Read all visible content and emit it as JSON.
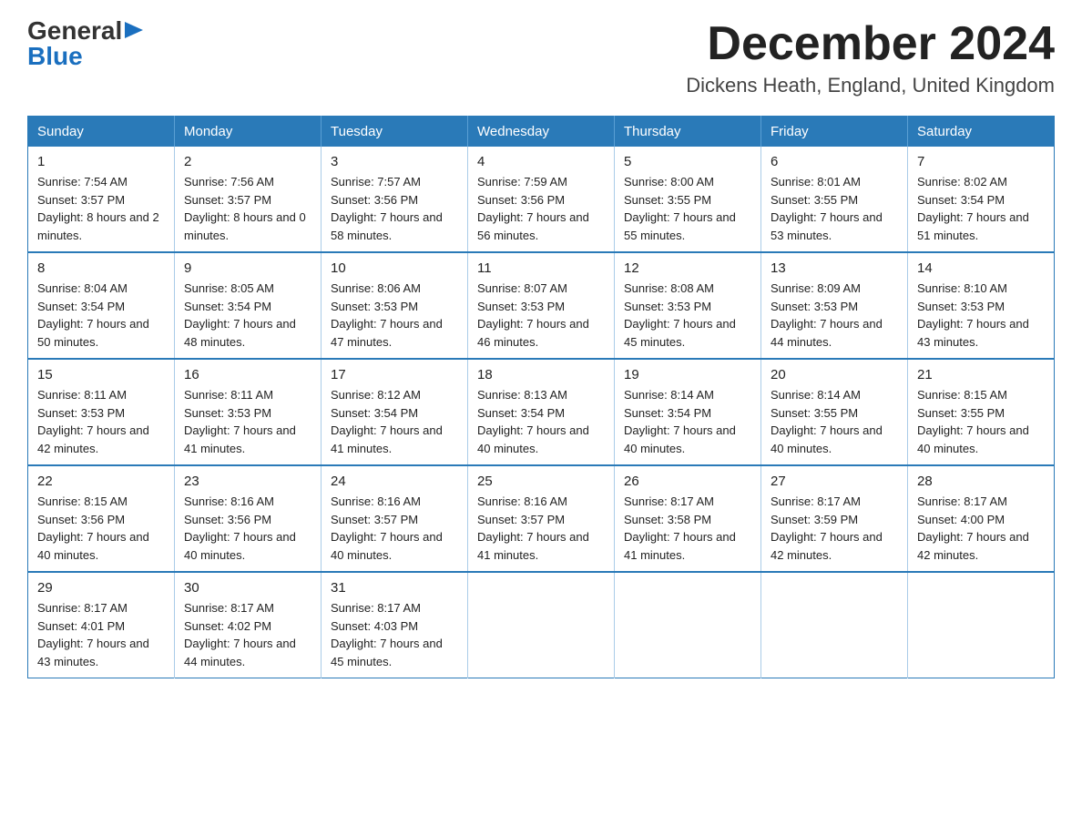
{
  "logo": {
    "general": "General",
    "arrow": "▶",
    "blue": "Blue"
  },
  "title": "December 2024",
  "location": "Dickens Heath, England, United Kingdom",
  "days_of_week": [
    "Sunday",
    "Monday",
    "Tuesday",
    "Wednesday",
    "Thursday",
    "Friday",
    "Saturday"
  ],
  "weeks": [
    [
      {
        "day": "1",
        "sunrise": "7:54 AM",
        "sunset": "3:57 PM",
        "daylight": "8 hours and 2 minutes."
      },
      {
        "day": "2",
        "sunrise": "7:56 AM",
        "sunset": "3:57 PM",
        "daylight": "8 hours and 0 minutes."
      },
      {
        "day": "3",
        "sunrise": "7:57 AM",
        "sunset": "3:56 PM",
        "daylight": "7 hours and 58 minutes."
      },
      {
        "day": "4",
        "sunrise": "7:59 AM",
        "sunset": "3:56 PM",
        "daylight": "7 hours and 56 minutes."
      },
      {
        "day": "5",
        "sunrise": "8:00 AM",
        "sunset": "3:55 PM",
        "daylight": "7 hours and 55 minutes."
      },
      {
        "day": "6",
        "sunrise": "8:01 AM",
        "sunset": "3:55 PM",
        "daylight": "7 hours and 53 minutes."
      },
      {
        "day": "7",
        "sunrise": "8:02 AM",
        "sunset": "3:54 PM",
        "daylight": "7 hours and 51 minutes."
      }
    ],
    [
      {
        "day": "8",
        "sunrise": "8:04 AM",
        "sunset": "3:54 PM",
        "daylight": "7 hours and 50 minutes."
      },
      {
        "day": "9",
        "sunrise": "8:05 AM",
        "sunset": "3:54 PM",
        "daylight": "7 hours and 48 minutes."
      },
      {
        "day": "10",
        "sunrise": "8:06 AM",
        "sunset": "3:53 PM",
        "daylight": "7 hours and 47 minutes."
      },
      {
        "day": "11",
        "sunrise": "8:07 AM",
        "sunset": "3:53 PM",
        "daylight": "7 hours and 46 minutes."
      },
      {
        "day": "12",
        "sunrise": "8:08 AM",
        "sunset": "3:53 PM",
        "daylight": "7 hours and 45 minutes."
      },
      {
        "day": "13",
        "sunrise": "8:09 AM",
        "sunset": "3:53 PM",
        "daylight": "7 hours and 44 minutes."
      },
      {
        "day": "14",
        "sunrise": "8:10 AM",
        "sunset": "3:53 PM",
        "daylight": "7 hours and 43 minutes."
      }
    ],
    [
      {
        "day": "15",
        "sunrise": "8:11 AM",
        "sunset": "3:53 PM",
        "daylight": "7 hours and 42 minutes."
      },
      {
        "day": "16",
        "sunrise": "8:11 AM",
        "sunset": "3:53 PM",
        "daylight": "7 hours and 41 minutes."
      },
      {
        "day": "17",
        "sunrise": "8:12 AM",
        "sunset": "3:54 PM",
        "daylight": "7 hours and 41 minutes."
      },
      {
        "day": "18",
        "sunrise": "8:13 AM",
        "sunset": "3:54 PM",
        "daylight": "7 hours and 40 minutes."
      },
      {
        "day": "19",
        "sunrise": "8:14 AM",
        "sunset": "3:54 PM",
        "daylight": "7 hours and 40 minutes."
      },
      {
        "day": "20",
        "sunrise": "8:14 AM",
        "sunset": "3:55 PM",
        "daylight": "7 hours and 40 minutes."
      },
      {
        "day": "21",
        "sunrise": "8:15 AM",
        "sunset": "3:55 PM",
        "daylight": "7 hours and 40 minutes."
      }
    ],
    [
      {
        "day": "22",
        "sunrise": "8:15 AM",
        "sunset": "3:56 PM",
        "daylight": "7 hours and 40 minutes."
      },
      {
        "day": "23",
        "sunrise": "8:16 AM",
        "sunset": "3:56 PM",
        "daylight": "7 hours and 40 minutes."
      },
      {
        "day": "24",
        "sunrise": "8:16 AM",
        "sunset": "3:57 PM",
        "daylight": "7 hours and 40 minutes."
      },
      {
        "day": "25",
        "sunrise": "8:16 AM",
        "sunset": "3:57 PM",
        "daylight": "7 hours and 41 minutes."
      },
      {
        "day": "26",
        "sunrise": "8:17 AM",
        "sunset": "3:58 PM",
        "daylight": "7 hours and 41 minutes."
      },
      {
        "day": "27",
        "sunrise": "8:17 AM",
        "sunset": "3:59 PM",
        "daylight": "7 hours and 42 minutes."
      },
      {
        "day": "28",
        "sunrise": "8:17 AM",
        "sunset": "4:00 PM",
        "daylight": "7 hours and 42 minutes."
      }
    ],
    [
      {
        "day": "29",
        "sunrise": "8:17 AM",
        "sunset": "4:01 PM",
        "daylight": "7 hours and 43 minutes."
      },
      {
        "day": "30",
        "sunrise": "8:17 AM",
        "sunset": "4:02 PM",
        "daylight": "7 hours and 44 minutes."
      },
      {
        "day": "31",
        "sunrise": "8:17 AM",
        "sunset": "4:03 PM",
        "daylight": "7 hours and 45 minutes."
      },
      null,
      null,
      null,
      null
    ]
  ],
  "labels": {
    "sunrise": "Sunrise:",
    "sunset": "Sunset:",
    "daylight": "Daylight:"
  }
}
